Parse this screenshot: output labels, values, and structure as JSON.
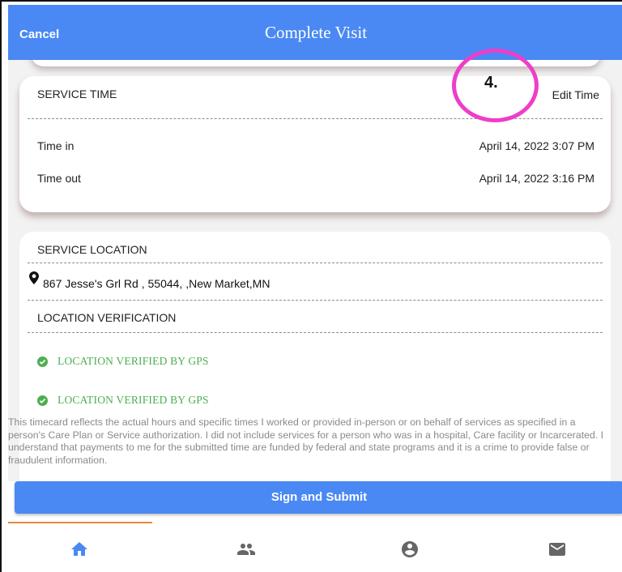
{
  "header": {
    "cancel_label": "Cancel",
    "title": "Complete Visit"
  },
  "service_time": {
    "heading": "SERVICE TIME",
    "edit_label": "Edit Time",
    "rows": [
      {
        "label": "Time in",
        "value": "April 14, 2022 3:07 PM"
      },
      {
        "label": "Time out",
        "value": "April 14, 2022 3:16 PM"
      }
    ]
  },
  "service_location": {
    "heading": "SERVICE LOCATION",
    "address": "867 Jesse's Grl Rd , 55044, ,New Market,MN",
    "verification_heading": "LOCATION VERIFICATION",
    "verifications": [
      "LOCATION VERIFIED BY GPS",
      "LOCATION VERIFIED BY GPS"
    ],
    "verified_color": "#4caf50"
  },
  "disclaimer": "This timecard reflects the actual hours and specific times I worked or provided in-person or on behalf of services as specified in a person's Care Plan or Service authorization. I did not include services for a person who was in a hospital, Care facility or Incarcerated. I understand that payments to me for the submitted time are funded by federal and state programs and it is a crime to provide false or fraudulent information.",
  "annotation": {
    "number": "4.",
    "color": "#ee3ec9"
  },
  "submit_label": "Sign and Submit",
  "bottom_nav": {
    "active_index": 0,
    "active_color": "#4a89f3",
    "indicator_color": "#e8893b",
    "items": [
      {
        "icon": "home-icon"
      },
      {
        "icon": "people-icon"
      },
      {
        "icon": "account-circle-icon"
      },
      {
        "icon": "mail-icon"
      }
    ]
  },
  "colors": {
    "brand": "#4a89f3"
  }
}
